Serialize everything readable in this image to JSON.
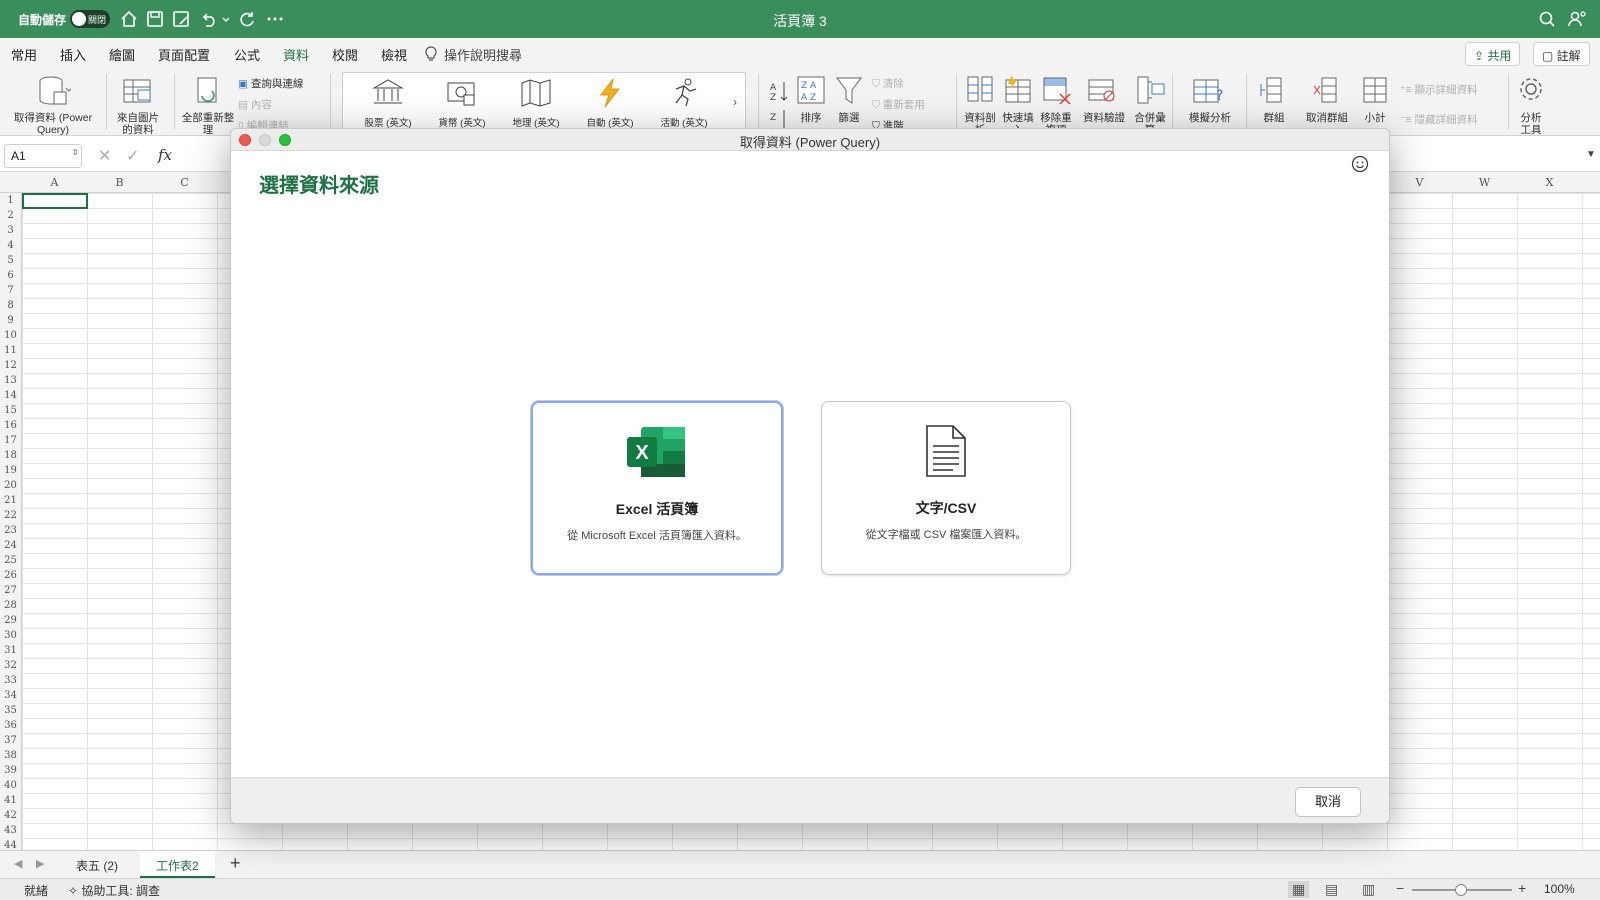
{
  "titlebar": {
    "autosave_label": "自動儲存",
    "autosave_state": "關閉",
    "title": "活頁簿 3"
  },
  "ribbon_tabs": [
    "常用",
    "插入",
    "繪圖",
    "頁面配置",
    "公式",
    "資料",
    "校閱",
    "檢視"
  ],
  "active_tab": "資料",
  "tell_me": "操作說明搜尋",
  "share_label": "共用",
  "comments_label": "註解",
  "ribbon": {
    "get_data": "取得資料 (Power Query)",
    "from_picture": "來自圖片的資料",
    "refresh_all": "全部重新整理",
    "queries_connections": "查詢與連線",
    "properties": "內容",
    "edit_links": "編輯連結",
    "gallery": [
      "股票 (英文)",
      "貨幣 (英文)",
      "地理 (英文)",
      "自動 (英文)",
      "活動 (英文)"
    ],
    "sort": "排序",
    "filter": "篩選",
    "clear": "清除",
    "reapply": "重新套用",
    "advanced": "進階",
    "text_to_columns": "資料剖析",
    "flash_fill": "快速填入",
    "remove_duplicates": "移除重複項",
    "data_validation": "資料驗證",
    "consolidate": "合併彙算",
    "what_if": "模擬分析",
    "group": "群組",
    "ungroup": "取消群組",
    "subtotal": "小計",
    "show_detail": "顯示詳細資料",
    "hide_detail": "隱藏詳細資料",
    "analysis_tools": "分析工具"
  },
  "formula_bar": {
    "name_box": "A1",
    "fx": "fx"
  },
  "columns_left": [
    "A",
    "B",
    "C"
  ],
  "columns_right": [
    "V",
    "W",
    "X"
  ],
  "rows": [
    "1",
    "2",
    "3",
    "4",
    "5",
    "6",
    "7",
    "8",
    "9",
    "10",
    "11",
    "12",
    "13",
    "14",
    "15",
    "16",
    "17",
    "18",
    "19",
    "20",
    "21",
    "22",
    "23",
    "24",
    "25",
    "26",
    "27",
    "28",
    "29",
    "30",
    "31",
    "32",
    "33",
    "34",
    "35",
    "36",
    "37",
    "38",
    "39",
    "40",
    "41",
    "42",
    "43",
    "44"
  ],
  "dialog": {
    "title": "取得資料 (Power Query)",
    "heading": "選擇資料來源",
    "cards": [
      {
        "title": "Excel 活頁簿",
        "desc": "從 Microsoft Excel 活頁簿匯入資料。",
        "selected": true
      },
      {
        "title": "文字/CSV",
        "desc": "從文字檔或 CSV 檔案匯入資料。",
        "selected": false
      }
    ],
    "cancel": "取消"
  },
  "sheets": [
    "表五 (2)",
    "工作表2"
  ],
  "active_sheet": "工作表2",
  "status": {
    "ready": "就緒",
    "accessibility": "協助工具: 調查",
    "zoom": "100%"
  },
  "colors": {
    "excel_green": "#1e7145",
    "titlebar_green": "#3a8e5c",
    "selected_card_border": "#8aa9e6"
  }
}
